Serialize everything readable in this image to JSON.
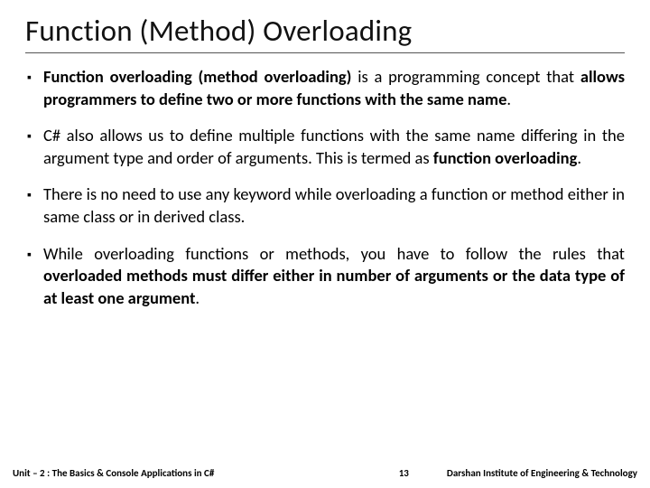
{
  "title": "Function (Method) Overloading",
  "bullets": [
    {
      "html": "<b>Function overloading (method overloading)</b> is a programming concept that <b>allows programmers to define two or more functions with the same name</b>."
    },
    {
      "html": "C# also allows us to define multiple functions with the same name differing in the argument type and order of arguments. This is termed as <b>function overloading</b>."
    },
    {
      "html": "There is no need to use any keyword while overloading a function or method either in same class or in derived class."
    },
    {
      "html": "While overloading functions or methods, you have to follow the rules that <b>overloaded methods must differ either in number of arguments or the data type of at least one argument</b>."
    }
  ],
  "footer": {
    "unit_label": "Unit – 2 : The Basics & Console Applications in C#",
    "page_number": "13",
    "institute": "Darshan Institute of Engineering & Technology"
  },
  "marker": "▪"
}
